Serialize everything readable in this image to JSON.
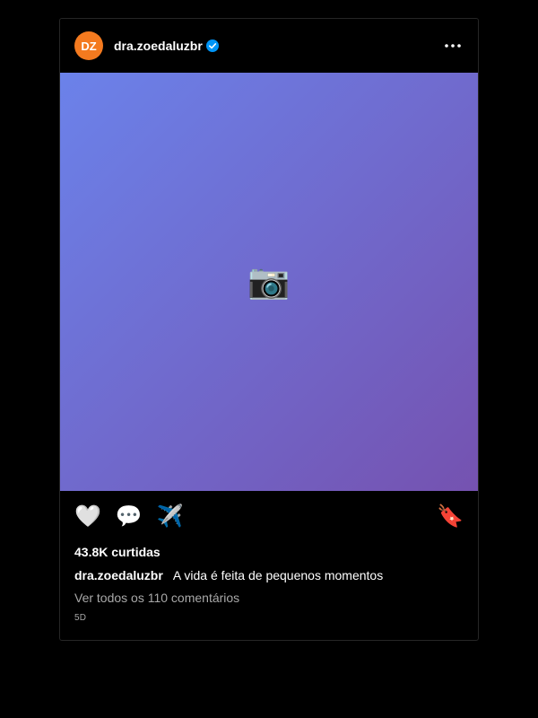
{
  "post": {
    "avatar_initials": "DZ",
    "username": "dra.zoedaluzbr",
    "verified": true,
    "more_icon": "more-horizontal-icon",
    "media_icon": "📷",
    "actions": {
      "like_icon": "🤍",
      "comment_icon": "💬",
      "share_icon": "✈️",
      "save_icon": "🔖"
    },
    "likes_text": "43.8K curtidas",
    "caption": {
      "user": "dra.zoedaluzbr",
      "text": "A vida é feita de pequenos momentos"
    },
    "comments_link": "Ver todos os 110 comentários",
    "timestamp": "5D",
    "colors": {
      "avatar": "#f47a1f",
      "verified": "#0095f6",
      "gradient_start": "#6b82ea",
      "gradient_end": "#7552b0"
    }
  }
}
